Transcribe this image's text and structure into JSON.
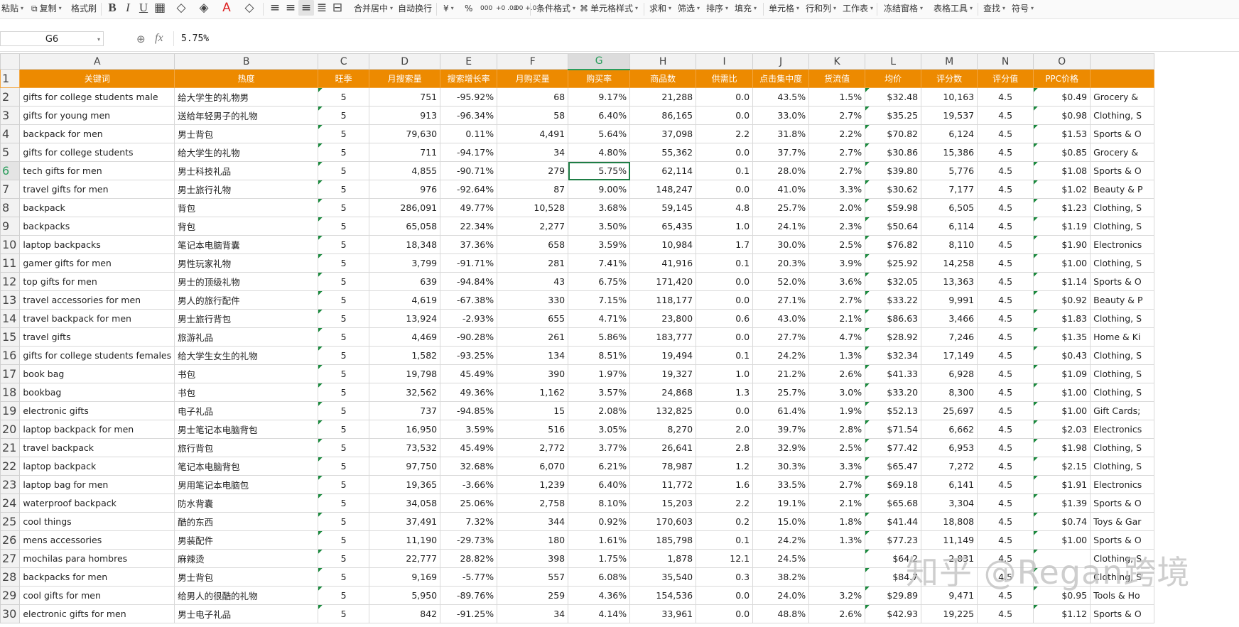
{
  "toolbar": {
    "paste": "粘贴",
    "copy": "复制",
    "format_painter": "格式刷",
    "bold": "B",
    "italic": "I",
    "underline": "U",
    "merge_center": "合并居中",
    "wrap_text": "自动换行",
    "currency": "¥",
    "percent": "%",
    "thousands": "000",
    "inc_decimal": "+0\n.00",
    "dec_decimal": ".00\n→.0",
    "cond_format": "条件格式",
    "cell_style": "单元格样式",
    "sum": "求和",
    "filter": "筛选",
    "sort": "排序",
    "fill": "填充",
    "cells": "单元格",
    "row_col": "行和列",
    "worksheet": "工作表",
    "freeze": "冻结窗格",
    "table_tools": "表格工具",
    "find": "查找",
    "symbol": "符号"
  },
  "formula_bar": {
    "name_box": "G6",
    "fx": "fx",
    "formula": "5.75%"
  },
  "columns": [
    "A",
    "B",
    "C",
    "D",
    "E",
    "F",
    "G",
    "H",
    "I",
    "J",
    "K",
    "L",
    "M",
    "N",
    "O"
  ],
  "selected_column": "G",
  "selected_row": 6,
  "header_row": {
    "rownum": "1",
    "cells": [
      "关键词",
      "热度",
      "旺季",
      "月搜索量",
      "搜索增长率",
      "月购买量",
      "购买率",
      "商品数",
      "供需比",
      "点击集中度",
      "货流值",
      "均价",
      "评分数",
      "评分值",
      "PPC价格"
    ]
  },
  "rows": [
    {
      "n": "2",
      "cells": [
        "gifts for college students male",
        "给大学生的礼物男",
        "5",
        "751",
        "-95.92%",
        "68",
        "9.17%",
        "21,288",
        "0.0",
        "43.5%",
        "1.5%",
        "$32.48",
        "10,163",
        "4.5",
        "$0.49",
        "Grocery &"
      ]
    },
    {
      "n": "3",
      "cells": [
        "gifts for young men",
        "送给年轻男子的礼物",
        "5",
        "913",
        "-96.34%",
        "58",
        "6.40%",
        "86,165",
        "0.0",
        "33.0%",
        "2.7%",
        "$35.25",
        "19,537",
        "4.5",
        "$0.98",
        "Clothing, S"
      ]
    },
    {
      "n": "4",
      "cells": [
        "backpack for men",
        "男士背包",
        "5",
        "79,630",
        "0.11%",
        "4,491",
        "5.64%",
        "37,098",
        "2.2",
        "31.8%",
        "2.2%",
        "$70.82",
        "6,124",
        "4.5",
        "$1.53",
        "Sports & O"
      ]
    },
    {
      "n": "5",
      "cells": [
        "gifts for college students",
        "给大学生的礼物",
        "5",
        "711",
        "-94.17%",
        "34",
        "4.80%",
        "55,362",
        "0.0",
        "37.7%",
        "2.7%",
        "$30.86",
        "15,386",
        "4.5",
        "$0.85",
        "Grocery &"
      ]
    },
    {
      "n": "6",
      "cells": [
        "tech gifts for men",
        "男士科技礼品",
        "5",
        "4,855",
        "-90.71%",
        "279",
        "5.75%",
        "62,114",
        "0.1",
        "28.0%",
        "2.7%",
        "$39.80",
        "5,776",
        "4.5",
        "$1.08",
        "Sports & O"
      ]
    },
    {
      "n": "7",
      "cells": [
        "travel gifts for men",
        "男士旅行礼物",
        "5",
        "976",
        "-92.64%",
        "87",
        "9.00%",
        "148,247",
        "0.0",
        "41.0%",
        "3.3%",
        "$30.62",
        "7,177",
        "4.5",
        "$1.02",
        "Beauty & P"
      ]
    },
    {
      "n": "8",
      "cells": [
        "backpack",
        "背包",
        "5",
        "286,091",
        "49.77%",
        "10,528",
        "3.68%",
        "59,145",
        "4.8",
        "25.7%",
        "2.0%",
        "$59.98",
        "6,505",
        "4.5",
        "$1.23",
        "Clothing, S"
      ]
    },
    {
      "n": "9",
      "cells": [
        "backpacks",
        "背包",
        "5",
        "65,058",
        "22.34%",
        "2,277",
        "3.50%",
        "65,435",
        "1.0",
        "24.1%",
        "2.3%",
        "$50.64",
        "6,114",
        "4.5",
        "$1.19",
        "Clothing, S"
      ]
    },
    {
      "n": "10",
      "cells": [
        "laptop backpacks",
        "笔记本电脑背囊",
        "5",
        "18,348",
        "37.36%",
        "658",
        "3.59%",
        "10,984",
        "1.7",
        "30.0%",
        "2.5%",
        "$76.82",
        "8,110",
        "4.5",
        "$1.90",
        "Electronics"
      ]
    },
    {
      "n": "11",
      "cells": [
        "gamer gifts for men",
        "男性玩家礼物",
        "5",
        "3,799",
        "-91.71%",
        "281",
        "7.41%",
        "41,916",
        "0.1",
        "20.3%",
        "3.9%",
        "$25.92",
        "14,258",
        "4.5",
        "$1.00",
        "Clothing, S"
      ]
    },
    {
      "n": "12",
      "cells": [
        "top gifts for men",
        "男士的顶级礼物",
        "5",
        "639",
        "-94.84%",
        "43",
        "6.75%",
        "171,420",
        "0.0",
        "52.0%",
        "3.6%",
        "$32.05",
        "13,363",
        "4.5",
        "$1.14",
        "Sports & O"
      ]
    },
    {
      "n": "13",
      "cells": [
        "travel accessories for men",
        "男人的旅行配件",
        "5",
        "4,619",
        "-67.38%",
        "330",
        "7.15%",
        "118,177",
        "0.0",
        "27.1%",
        "2.7%",
        "$33.22",
        "9,991",
        "4.5",
        "$0.92",
        "Beauty & P"
      ]
    },
    {
      "n": "14",
      "cells": [
        "travel backpack for men",
        "男士旅行背包",
        "5",
        "13,924",
        "-2.93%",
        "655",
        "4.71%",
        "23,800",
        "0.6",
        "43.0%",
        "2.1%",
        "$86.63",
        "3,466",
        "4.5",
        "$1.83",
        "Clothing, S"
      ]
    },
    {
      "n": "15",
      "cells": [
        "travel gifts",
        "旅游礼品",
        "5",
        "4,469",
        "-90.28%",
        "261",
        "5.86%",
        "183,777",
        "0.0",
        "27.7%",
        "4.7%",
        "$28.92",
        "7,246",
        "4.5",
        "$1.35",
        "Home & Ki"
      ]
    },
    {
      "n": "16",
      "cells": [
        "gifts for college students females",
        "给大学生女生的礼物",
        "5",
        "1,582",
        "-93.25%",
        "134",
        "8.51%",
        "19,494",
        "0.1",
        "24.2%",
        "1.3%",
        "$32.34",
        "17,149",
        "4.5",
        "$0.43",
        "Clothing, S"
      ]
    },
    {
      "n": "17",
      "cells": [
        "book bag",
        "书包",
        "5",
        "19,798",
        "45.49%",
        "390",
        "1.97%",
        "19,327",
        "1.0",
        "21.2%",
        "2.6%",
        "$41.33",
        "6,928",
        "4.5",
        "$1.09",
        "Clothing, S"
      ]
    },
    {
      "n": "18",
      "cells": [
        "bookbag",
        "书包",
        "5",
        "32,562",
        "49.36%",
        "1,162",
        "3.57%",
        "24,868",
        "1.3",
        "25.7%",
        "3.0%",
        "$33.20",
        "8,300",
        "4.5",
        "$1.00",
        "Clothing, S"
      ]
    },
    {
      "n": "19",
      "cells": [
        "electronic gifts",
        "电子礼品",
        "5",
        "737",
        "-94.85%",
        "15",
        "2.08%",
        "132,825",
        "0.0",
        "61.4%",
        "1.9%",
        "$52.13",
        "25,697",
        "4.5",
        "$1.00",
        "Gift Cards;"
      ]
    },
    {
      "n": "20",
      "cells": [
        "laptop backpack for men",
        "男士笔记本电脑背包",
        "5",
        "16,950",
        "3.59%",
        "516",
        "3.05%",
        "8,270",
        "2.0",
        "39.7%",
        "2.8%",
        "$71.54",
        "6,662",
        "4.5",
        "$2.03",
        "Electronics"
      ]
    },
    {
      "n": "21",
      "cells": [
        "travel backpack",
        "旅行背包",
        "5",
        "73,532",
        "45.49%",
        "2,772",
        "3.77%",
        "26,641",
        "2.8",
        "32.9%",
        "2.5%",
        "$77.42",
        "6,953",
        "4.5",
        "$1.98",
        "Clothing, S"
      ]
    },
    {
      "n": "22",
      "cells": [
        "laptop backpack",
        "笔记本电脑背包",
        "5",
        "97,750",
        "32.68%",
        "6,070",
        "6.21%",
        "78,987",
        "1.2",
        "30.3%",
        "3.3%",
        "$65.47",
        "7,272",
        "4.5",
        "$2.15",
        "Clothing, S"
      ]
    },
    {
      "n": "23",
      "cells": [
        "laptop bag for men",
        "男用笔记本电脑包",
        "5",
        "19,365",
        "-3.66%",
        "1,239",
        "6.40%",
        "11,772",
        "1.6",
        "33.5%",
        "2.7%",
        "$69.18",
        "6,141",
        "4.5",
        "$1.91",
        "Electronics"
      ]
    },
    {
      "n": "24",
      "cells": [
        "waterproof backpack",
        "防水背囊",
        "5",
        "34,058",
        "25.06%",
        "2,758",
        "8.10%",
        "15,203",
        "2.2",
        "19.1%",
        "2.1%",
        "$65.68",
        "3,304",
        "4.5",
        "$1.39",
        "Sports & O"
      ]
    },
    {
      "n": "25",
      "cells": [
        "cool things",
        "酷的东西",
        "5",
        "37,491",
        "7.32%",
        "344",
        "0.92%",
        "170,603",
        "0.2",
        "15.0%",
        "1.8%",
        "$41.44",
        "18,808",
        "4.5",
        "$0.74",
        "Toys & Gar"
      ]
    },
    {
      "n": "26",
      "cells": [
        "mens accessories",
        "男装配件",
        "5",
        "11,190",
        "-29.73%",
        "180",
        "1.61%",
        "185,798",
        "0.1",
        "24.2%",
        "1.3%",
        "$77.23",
        "11,149",
        "4.5",
        "$1.00",
        "Sports & O"
      ]
    },
    {
      "n": "27",
      "cells": [
        "mochilas para hombres",
        "麻辣烫",
        "5",
        "22,777",
        "28.82%",
        "398",
        "1.75%",
        "1,878",
        "12.1",
        "24.5%",
        "",
        "$64.2",
        "2,831",
        "4.5",
        "",
        "Clothing, S"
      ]
    },
    {
      "n": "28",
      "cells": [
        "backpacks for men",
        "男士背包",
        "5",
        "9,169",
        "-5.77%",
        "557",
        "6.08%",
        "35,540",
        "0.3",
        "38.2%",
        "",
        "$84.7",
        "",
        "4.5",
        "",
        "Clothing, S"
      ]
    },
    {
      "n": "29",
      "cells": [
        "cool gifts for men",
        "给男人的很酷的礼物",
        "5",
        "5,950",
        "-89.76%",
        "259",
        "4.36%",
        "154,536",
        "0.0",
        "24.0%",
        "3.2%",
        "$29.89",
        "9,471",
        "4.5",
        "$0.95",
        "Tools & Ho"
      ]
    },
    {
      "n": "30",
      "cells": [
        "electronic gifts for men",
        "男士电子礼品",
        "5",
        "842",
        "-91.25%",
        "34",
        "4.14%",
        "33,961",
        "0.0",
        "48.8%",
        "2.6%",
        "$42.93",
        "19,225",
        "4.5",
        "$1.12",
        "Sports & O"
      ]
    }
  ],
  "watermark": "知乎 @Regan跨境",
  "colors": {
    "header_fill": "#ed8a00",
    "selection": "#1e7d45",
    "selected_header_text": "#2a9d5c"
  }
}
